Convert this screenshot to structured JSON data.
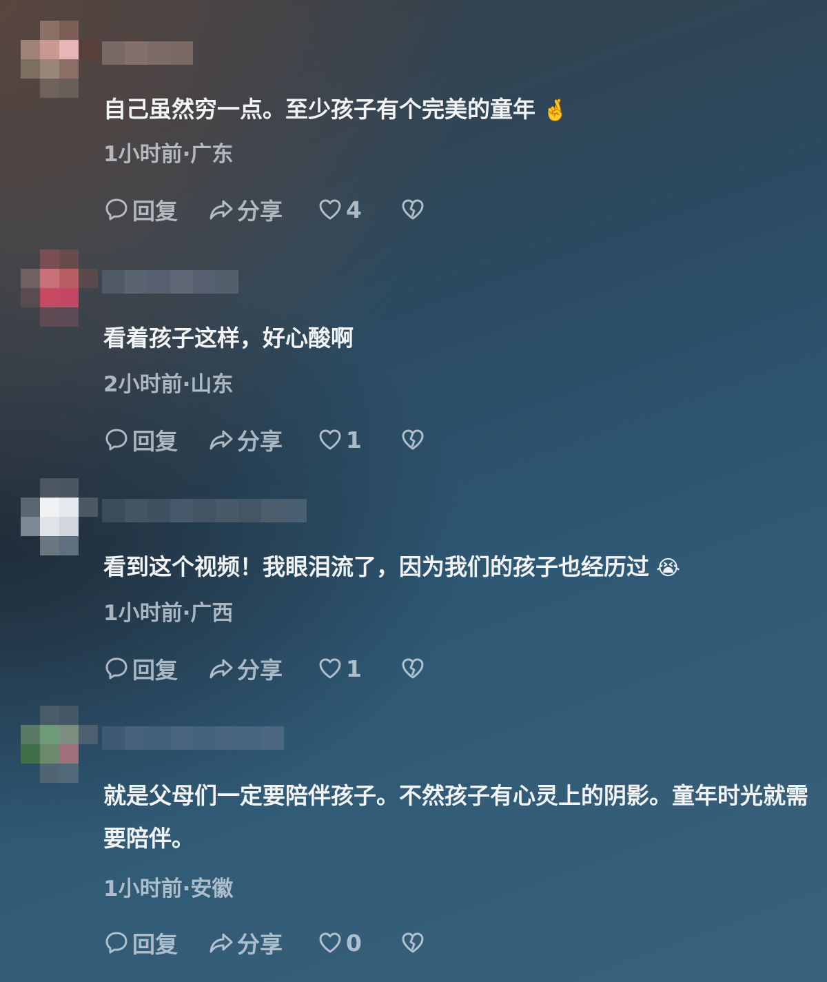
{
  "comments": [
    {
      "text": "自己虽然穷一点。至少孩子有个完美的童年",
      "emoji": "🤞",
      "meta": "1小时前·广东",
      "reply_label": "回复",
      "share_label": "分享",
      "like_count": "4"
    },
    {
      "text": "看着孩子这样，好心酸啊",
      "emoji": "",
      "meta": "2小时前·山东",
      "reply_label": "回复",
      "share_label": "分享",
      "like_count": "1"
    },
    {
      "text": "看到这个视频！我眼泪流了，因为我们的孩子也经历过",
      "emoji": "😭",
      "meta": "1小时前·广西",
      "reply_label": "回复",
      "share_label": "分享",
      "like_count": "1"
    },
    {
      "text": "就是父母们一定要陪伴孩子。不然孩子有心灵上的阴影。童年时光就需要陪伴。",
      "emoji": "",
      "meta": "1小时前·安徽",
      "reply_label": "回复",
      "share_label": "分享",
      "like_count": "0"
    }
  ],
  "icons": {
    "reply": "comment-bubble-icon",
    "share": "share-arrow-icon",
    "like": "heart-icon",
    "dislike": "broken-heart-icon"
  }
}
